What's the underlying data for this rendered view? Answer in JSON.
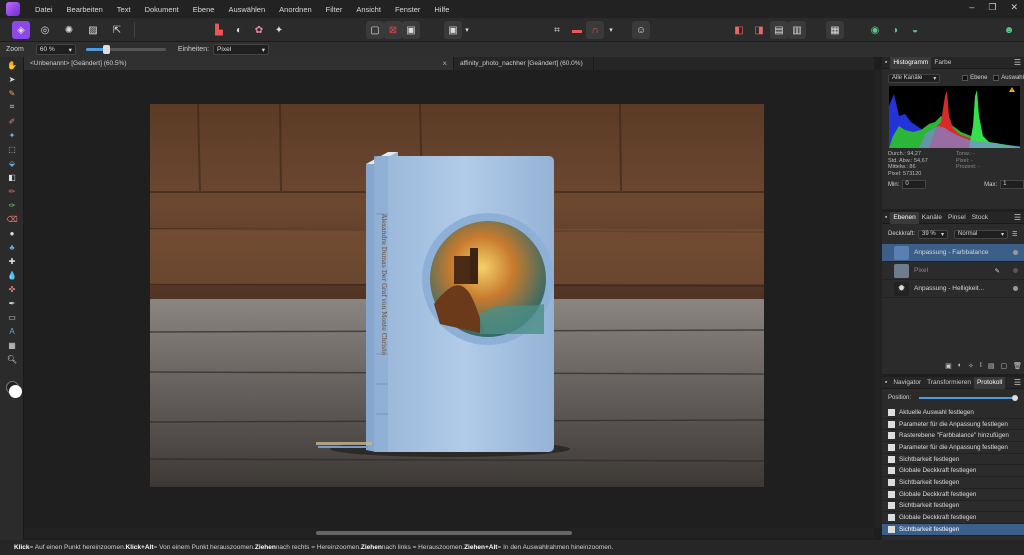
{
  "menu": {
    "items": [
      "Datei",
      "Bearbeiten",
      "Text",
      "Dokument",
      "Ebene",
      "Auswählen",
      "Anordnen",
      "Filter",
      "Ansicht",
      "Fenster",
      "Hilfe"
    ],
    "window_controls": [
      "–",
      "❐",
      "✕"
    ]
  },
  "context": {
    "zoom_label": "Zoom",
    "zoom_value": "60 %",
    "units_label": "Einheiten:",
    "units_value": "Pixel",
    "zoom_slider_fraction": 0.25
  },
  "tabs": {
    "doc1": "<Unbenannt> [Geändert] (60.5%)",
    "doc2": "affinity_photo_nachher [Geändert] (60.0%)",
    "close": "×"
  },
  "histogram_panel": {
    "tabs": [
      "Histogramm",
      "Farbe"
    ],
    "channel": "Alle Kanäle",
    "option_layer": "Ebene",
    "option_selection": "Auswahl",
    "stats_left": [
      "Durch.: 94,27",
      "Std. Abw.: 54,67",
      "Mittelw.: 86",
      "Pixel: 573120"
    ],
    "stats_right": [
      "Tonw.: -",
      "Pixel: -",
      "Prozent: -"
    ],
    "min_label": "Min:",
    "min_value": "0",
    "max_label": "Max:",
    "max_value": "1"
  },
  "layers_panel": {
    "tabs": [
      "Ebenen",
      "Kanäle",
      "Pinsel",
      "Stock"
    ],
    "opacity_label": "Deckkraft:",
    "opacity_value": "39 %",
    "blend_mode": "Normal",
    "layers": [
      {
        "name": "Anpassung - Farbbalance",
        "selected": true
      },
      {
        "name": "Pixel",
        "selected": false
      },
      {
        "name": "Anpassung - Helligkeit...",
        "selected": false
      }
    ]
  },
  "history_panel": {
    "tabs": [
      "Navigator",
      "Transformieren",
      "Protokoll"
    ],
    "position_label": "Position:",
    "items": [
      "Aktuelle Auswahl festlegen",
      "Parameter für die Anpassung festlegen",
      "Rasterebene \"Farbbalance\" hinzufügen",
      "Parameter für die Anpassung festlegen",
      "Sichtbarkeit festlegen",
      "Globale Deckkraft festlegen",
      "Sichtbarkeit festlegen",
      "Globale Deckkraft festlegen",
      "Sichtbarkeit festlegen",
      "Globale Deckkraft festlegen",
      "Sichtbarkeit festlegen"
    ],
    "selected_index": 10
  },
  "status": {
    "segments": [
      {
        "bold": "Klick",
        "text": " = Auf einen Punkt hereinzoomen. "
      },
      {
        "bold": "Klick+Alt",
        "text": " = Von einem Punkt herauszoomen. "
      },
      {
        "bold": "Ziehen",
        "text": " nach rechts = Hereinzoomen. "
      },
      {
        "bold": "Ziehen",
        "text": " nach links = Herauszoomen. "
      },
      {
        "bold": "Ziehen+Alt",
        "text": " = In den Auswahlrahmen hineinzoomen."
      }
    ]
  },
  "colors": {
    "accent": "#8e47e8",
    "selection": "#3c5f8a",
    "book": "#a7c3e4"
  }
}
